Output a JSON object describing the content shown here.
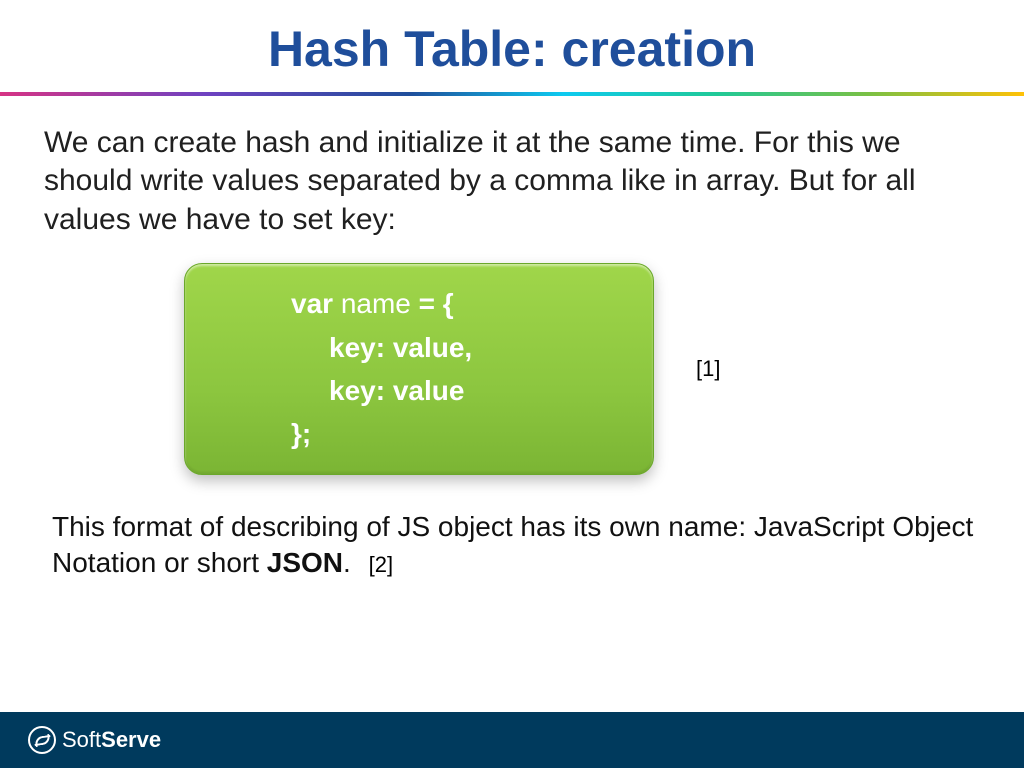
{
  "title": "Hash Table: creation",
  "paragraph1": "We can create hash and initialize it at the same time. For this we should write values separated by a comma like in array. But for all values we have to set key:",
  "code": {
    "line1_kw_var": "var",
    "line1_name": " name ",
    "line1_kw_brace": "= {",
    "line2": "key: value,",
    "line3": "key: value",
    "line4": "};"
  },
  "ref1": "[1]",
  "paragraph2_a": "This format of describing of JS object has its own name: JavaScript Object Notation or short ",
  "paragraph2_bold": "JSON",
  "paragraph2_dot": ".",
  "ref2": "[2]",
  "footer": {
    "brand_a": "Soft",
    "brand_b": "Serve"
  }
}
